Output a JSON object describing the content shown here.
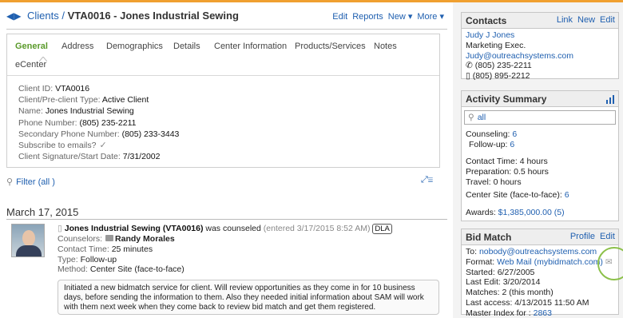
{
  "header": {
    "breadcrumb_clients": "Clients",
    "separator": " / ",
    "title": "VTA0016 - Jones Industrial Sewing",
    "actions": [
      "Edit",
      "Reports",
      "New ▾",
      "More ▾"
    ]
  },
  "tabs": [
    "General",
    "Address",
    "Demographics",
    "Details",
    "Center Information",
    "Products/Services",
    "Notes",
    "eCenter"
  ],
  "active_tab": "General",
  "fields": [
    {
      "label": "Client ID:",
      "value": "VTA0016"
    },
    {
      "label": "Client/Pre-client Type:",
      "value": "Active Client"
    },
    {
      "label": "Name:",
      "value": "Jones Industrial Sewing"
    },
    {
      "label": "Phone Number:",
      "value": "(805) 235-2211"
    },
    {
      "label": "Secondary Phone Number:",
      "value": "(805) 233-3443"
    },
    {
      "label": "Subscribe to emails?",
      "value": "✓"
    },
    {
      "label": "Client Signature/Start Date:",
      "value": "7/31/2002"
    }
  ],
  "filter_label": "Filter (all )",
  "date_heading": "March 17, 2015",
  "entry": {
    "who": "Jones Industrial Sewing (VTA0016)",
    "action": " was counseled ",
    "entered": "(entered 3/17/2015 8:52 AM)",
    "badge": "DLA",
    "counselors_label": "Counselors:",
    "counselor": "Randy Morales",
    "contact_time_label": "Contact Time:",
    "contact_time": "25 minutes",
    "type_label": "Type:",
    "type": "Follow-up",
    "method_label": "Method:",
    "method": "Center Site (face-to-face)",
    "note": "Initiated a new bidmatch service for client. Will review opportunities as they come in for 10 business days, before sending the information to them. Also they needed initial information about SAM will work with them next week when they come back to review bid match and get them registered."
  },
  "contacts": {
    "title": "Contacts",
    "actions": [
      "Link",
      "New",
      "Edit"
    ],
    "name": "Judy J Jones",
    "role": "Marketing Exec.",
    "email": "Judy@outreachsystems.com",
    "phone1": "(805) 235-2211",
    "phone2": "(805) 895-2212"
  },
  "activity": {
    "title": "Activity Summary",
    "search_value": "all",
    "counseling_label": "Counseling:",
    "counseling": "6",
    "followup_label": "Follow-up:",
    "followup": "6",
    "contact_time": "Contact Time: 4 hours",
    "preparation": "Preparation: 0.5 hours",
    "travel": "Travel: 0 hours",
    "center_site_label": "Center Site (face-to-face):",
    "center_site": "6",
    "awards_label": "Awards:",
    "awards": "$1,385,000.00 (5)"
  },
  "bidmatch": {
    "title": "Bid Match",
    "actions": [
      "Profile",
      "Edit"
    ],
    "to_label": "To:",
    "to": "nobody@outreachsystems.com",
    "format_label": "Format:",
    "format": "Web Mail (mybidmatch.com)",
    "started": "Started: 6/27/2005",
    "last_edit": "Last Edit: 3/20/2014",
    "matches": "Matches: 2 (this month)",
    "last_access": "Last access: 4/13/2015 11:50 AM",
    "master_label": "Master Index for :",
    "master": "2863"
  },
  "colors": {
    "link": "#2060b0",
    "active_tab": "#5a9a2a",
    "top_accent": "#f0a030",
    "highlight_circle": "#8cc04a"
  }
}
